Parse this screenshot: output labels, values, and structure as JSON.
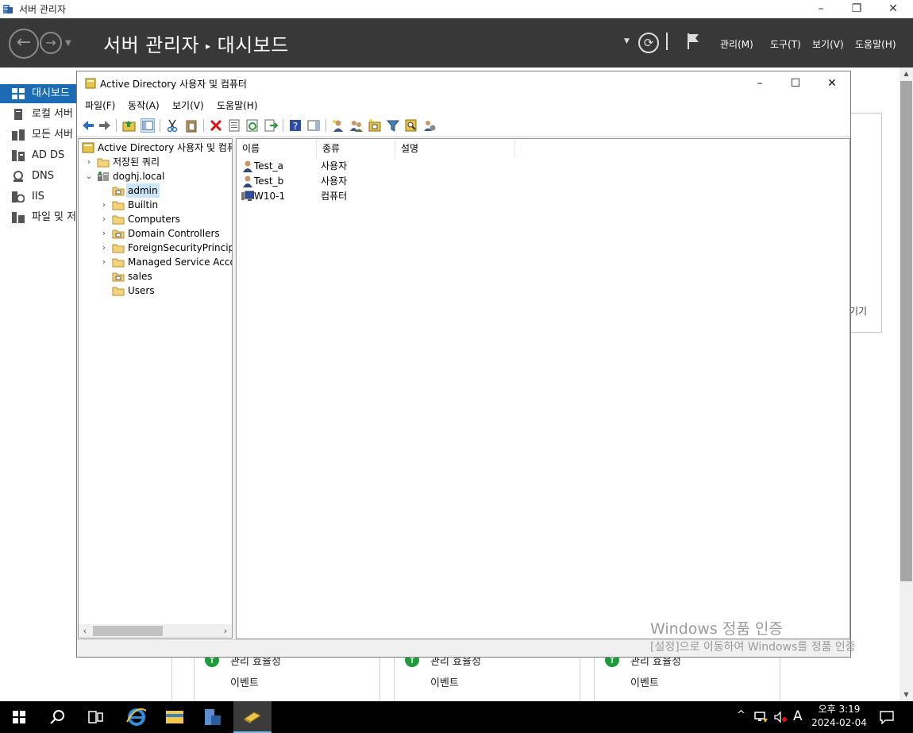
{
  "server_manager": {
    "window_title": "서버 관리자",
    "breadcrumb_app": "서버 관리자",
    "breadcrumb_page": "대시보드",
    "menus": [
      "관리(M)",
      "도구(T)",
      "보기(V)",
      "도움말(H)"
    ],
    "nav_items": [
      {
        "label": "대시보드",
        "icon": "dashboard-icon",
        "active": true
      },
      {
        "label": "로컬 서버",
        "icon": "local-server-icon",
        "active": false
      },
      {
        "label": "모든 서버",
        "icon": "all-servers-icon",
        "active": false
      },
      {
        "label": "AD DS",
        "icon": "ad-ds-icon",
        "active": false
      },
      {
        "label": "DNS",
        "icon": "dns-icon",
        "active": false
      },
      {
        "label": "IIS",
        "icon": "iis-icon",
        "active": false
      },
      {
        "label": "파일 및 저장소 서비스",
        "icon": "file-storage-icon",
        "active": false
      }
    ],
    "bg_panel_text": "기기",
    "tiles": [
      {
        "line1": "관리 효율성",
        "line2": "이벤트"
      },
      {
        "line1": "관리 효율성",
        "line2": "이벤트"
      },
      {
        "line1": "관리 효율성",
        "line2": "이벤트"
      }
    ]
  },
  "aduc": {
    "title": "Active Directory 사용자 및 컴퓨터",
    "menus": [
      "파일(F)",
      "동작(A)",
      "보기(V)",
      "도움말(H)"
    ],
    "tree": [
      {
        "label": "Active Directory 사용자 및 컴퓨터",
        "indent": 0,
        "expander": "",
        "icon": "aduc-root-icon",
        "selected": false
      },
      {
        "label": "저장된 쿼리",
        "indent": 1,
        "expander": "›",
        "icon": "folder-icon",
        "selected": false
      },
      {
        "label": "doghj.local",
        "indent": 1,
        "expander": "⌄",
        "icon": "domain-icon",
        "selected": false
      },
      {
        "label": "admin",
        "indent": 2,
        "expander": "",
        "icon": "ou-icon",
        "selected": true
      },
      {
        "label": "Builtin",
        "indent": 2,
        "expander": "›",
        "icon": "folder-icon",
        "selected": false
      },
      {
        "label": "Computers",
        "indent": 2,
        "expander": "›",
        "icon": "folder-icon",
        "selected": false
      },
      {
        "label": "Domain Controllers",
        "indent": 2,
        "expander": "›",
        "icon": "ou-icon",
        "selected": false
      },
      {
        "label": "ForeignSecurityPrincipals",
        "indent": 2,
        "expander": "›",
        "icon": "folder-icon",
        "selected": false
      },
      {
        "label": "Managed Service Accounts",
        "indent": 2,
        "expander": "›",
        "icon": "folder-icon",
        "selected": false
      },
      {
        "label": "sales",
        "indent": 2,
        "expander": "",
        "icon": "ou-icon",
        "selected": false
      },
      {
        "label": "Users",
        "indent": 2,
        "expander": "",
        "icon": "folder-icon",
        "selected": false
      }
    ],
    "list_columns": [
      "이름",
      "종류",
      "설명"
    ],
    "list_rows": [
      {
        "name": "Test_a",
        "type": "사용자",
        "description": "",
        "icon": "user-icon"
      },
      {
        "name": "Test_b",
        "type": "사용자",
        "description": "",
        "icon": "user-icon"
      },
      {
        "name": "W10-1",
        "type": "컴퓨터",
        "description": "",
        "icon": "computer-icon"
      }
    ]
  },
  "watermark": {
    "line1": "Windows 정품 인증",
    "line2": "[설정]으로 이동하여 Windows를 정품 인증"
  },
  "taskbar": {
    "time": "오후 3:19",
    "date": "2024-02-04",
    "ime": "A"
  }
}
